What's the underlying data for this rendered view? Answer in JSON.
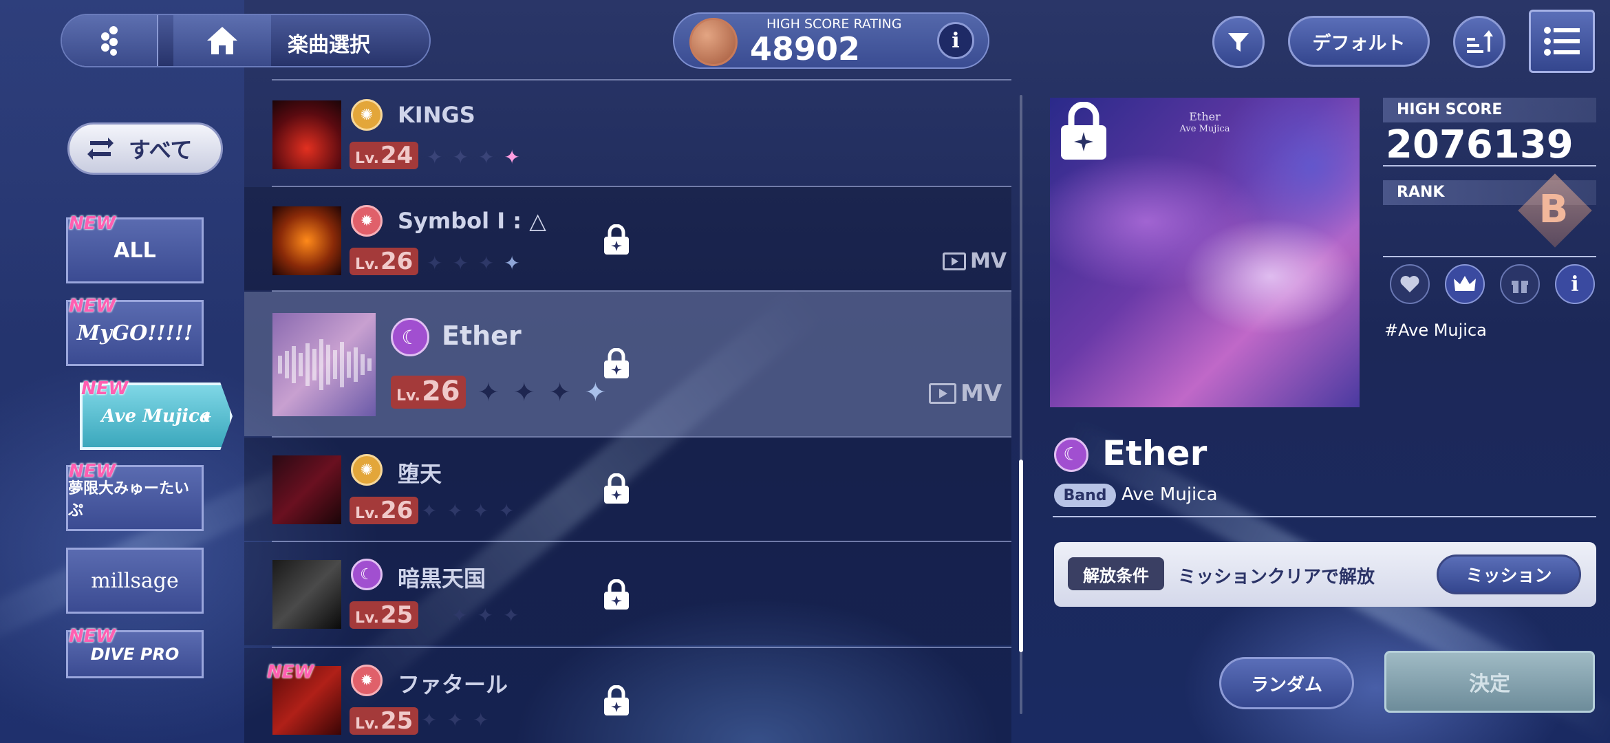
{
  "header": {
    "screen_title": "楽曲選択",
    "rating_label": "HIGH SCORE RATING",
    "rating_value": "48902",
    "info_icon_text": "i"
  },
  "toolbar": {
    "sort_label": "デフォルト"
  },
  "sidebar": {
    "filter_toggle_label": "すべて",
    "tabs": [
      {
        "label": "ALL",
        "new": "NEW"
      },
      {
        "label": "MyGO!!!!!",
        "new": "NEW"
      },
      {
        "label": "Ave Mujica",
        "new": "NEW",
        "selected": true
      },
      {
        "label": "夢限大みゅーたいぷ",
        "new": "NEW"
      },
      {
        "label": "millsage",
        "new": ""
      },
      {
        "label": "DIVE PRO",
        "new": "NEW"
      }
    ]
  },
  "songs": [
    {
      "title": "KINGS",
      "lv_prefix": "Lv.",
      "level": "24",
      "attr_color": "#e3a63a",
      "locked": false,
      "mv": "",
      "new": ""
    },
    {
      "title": "Symbol I : △",
      "lv_prefix": "Lv.",
      "level": "26",
      "attr_color": "#e0606a",
      "locked": true,
      "mv": "MV",
      "new": ""
    },
    {
      "title": "Ether",
      "lv_prefix": "Lv.",
      "level": "26",
      "attr_color": "#a14fd0",
      "locked": true,
      "mv": "MV",
      "new": "",
      "selected": true
    },
    {
      "title": "堕天",
      "lv_prefix": "Lv.",
      "level": "26",
      "attr_color": "#e3a63a",
      "locked": true,
      "mv": "",
      "new": ""
    },
    {
      "title": "暗黒天国",
      "lv_prefix": "Lv.",
      "level": "25",
      "attr_color": "#a14fd0",
      "locked": true,
      "mv": "",
      "new": ""
    },
    {
      "title": "ファタール",
      "lv_prefix": "Lv.",
      "level": "25",
      "attr_color": "#e0606a",
      "locked": true,
      "mv": "",
      "new": "NEW"
    }
  ],
  "detail": {
    "jacket_title": "Ether",
    "jacket_artist": "Ave Mujica",
    "high_score_label": "HIGH SCORE",
    "high_score": "2076139",
    "rank_label": "RANK",
    "rank": "B",
    "hashtag": "#Ave Mujica",
    "title": "Ether",
    "band_chip": "Band",
    "band_name": "Ave Mujica",
    "unlock_label": "解放条件",
    "unlock_text": "ミッションクリアで解放",
    "mission_button": "ミッション"
  },
  "footer": {
    "random_button": "ランダム",
    "decide_button": "決定"
  },
  "colors": {
    "accent_blue": "#34468e",
    "selected_tab": "#3aa7bc",
    "level_badge": "#a43a3a",
    "new_badge": "#ff5fb1"
  }
}
